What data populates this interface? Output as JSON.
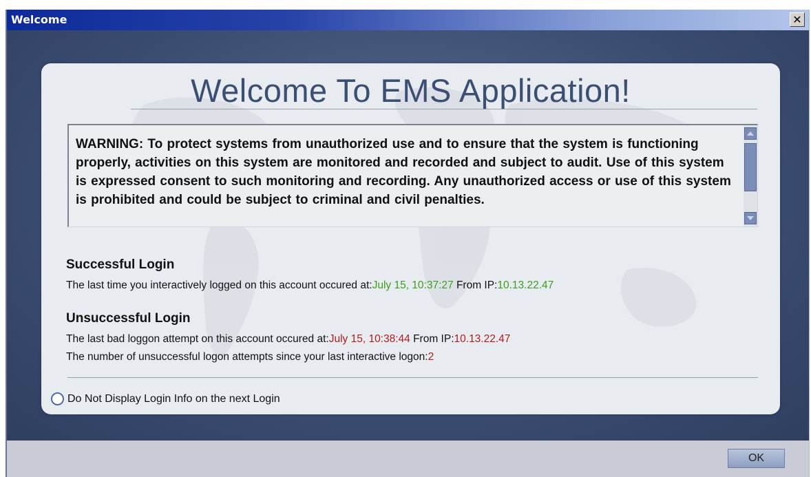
{
  "window": {
    "title": "Welcome",
    "close_glyph": "✕"
  },
  "panel": {
    "heading": "Welcome To EMS Application!",
    "warning_text": "WARNING: To protect systems from unauthorized use and to ensure that the system is functioning properly, activities on this system are monitored and recorded and subject to audit. Use of this system is expressed consent to such monitoring and recording. Any unauthorized access or use of this system is prohibited and could be subject to criminal and civil penalties.",
    "successful": {
      "title": "Successful Login",
      "prefix": "The last time you interactively logged on this account occured at:",
      "time": "July 15, 10:37:27",
      "ip_label": " From IP:",
      "ip": "10.13.22.47"
    },
    "unsuccessful": {
      "title": "Unsuccessful Login",
      "prefix": "The last bad loggon attempt on this account occured at:",
      "time": "July 15, 10:38:44",
      "ip_label": " From IP:",
      "ip": "10.13.22.47",
      "count_prefix": "The number of unsuccessful logon attempts since your last interactive logon:",
      "count": "2"
    },
    "radio_label": "Do Not Display Login Info on the next Login"
  },
  "footer": {
    "ok_label": "OK"
  },
  "colors": {
    "title_bar_start": "#0d2a9a",
    "success": "#3aa01e",
    "failure": "#b01c1c",
    "heading": "#3b4e73"
  }
}
